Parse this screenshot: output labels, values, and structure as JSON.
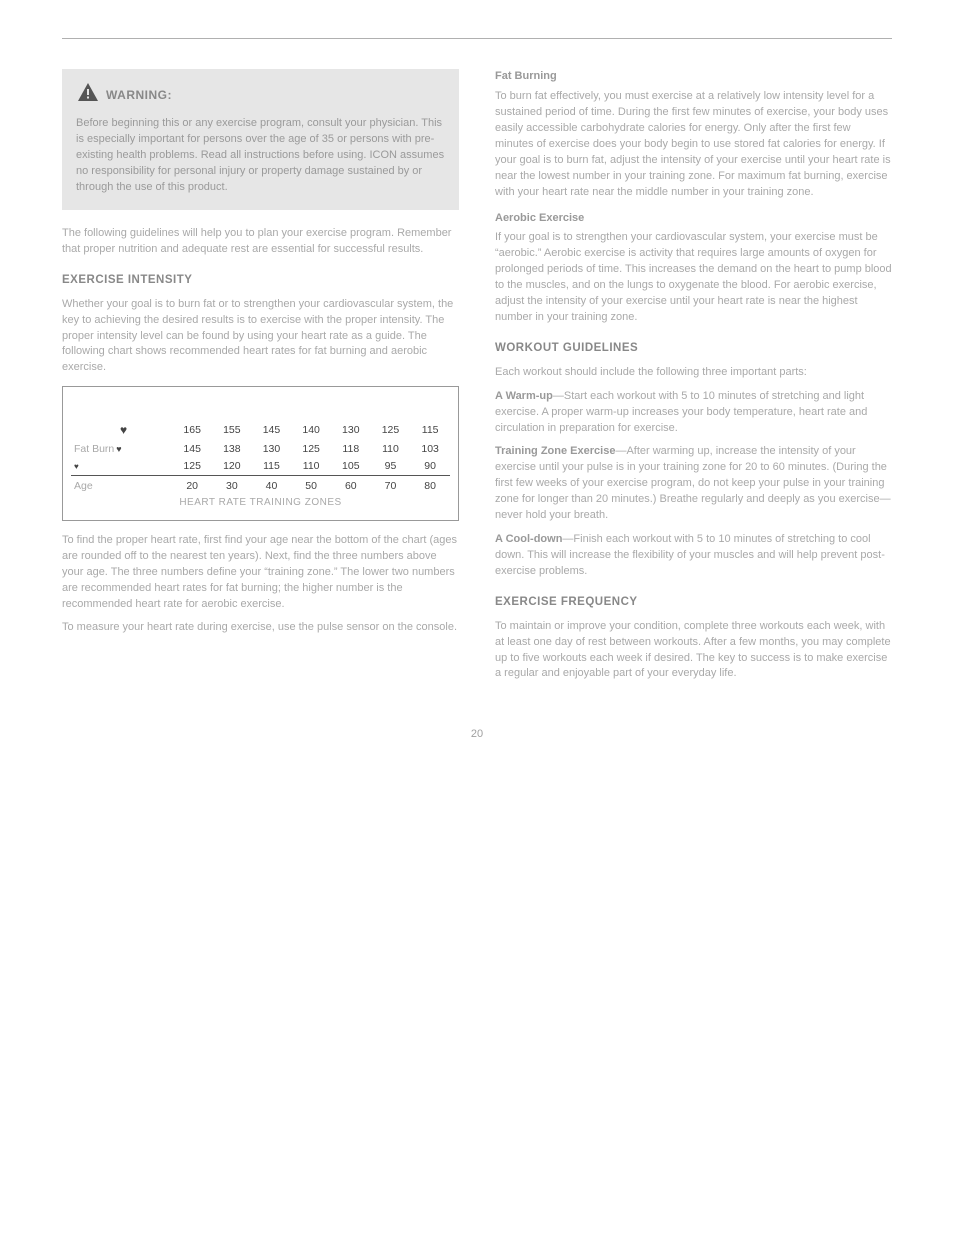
{
  "header_right": "",
  "warning": {
    "label": "WARNING:",
    "body": "Before beginning this or any exercise program, consult your physician. This is especially important for persons over the age of 35 or persons with pre-existing health problems. Read all instructions before using. ICON assumes no responsibility for personal injury or property damage sustained by or through the use of this product."
  },
  "exercise": {
    "para1": "The following guidelines will help you to plan your exercise program. Remember that proper nutrition and adequate rest are essential for successful results.",
    "title": "EXERCISE INTENSITY",
    "para2": "Whether your goal is to burn fat or to strengthen your cardiovascular system, the key to achieving the desired results is to exercise with the proper intensity. The proper intensity level can be found by using your heart rate as a guide. The following chart shows recommended heart rates for fat burning and aerobic exercise."
  },
  "chart_data": {
    "type": "table",
    "title": "",
    "rows": [
      {
        "label": "",
        "icon": "heart-lg",
        "values": [
          165,
          155,
          145,
          140,
          130,
          125,
          115
        ]
      },
      {
        "label": "Fat Burn",
        "icon": "heart-md",
        "values": [
          145,
          138,
          130,
          125,
          118,
          110,
          103
        ]
      },
      {
        "label": "",
        "icon": "heart-sm",
        "values": [
          125,
          120,
          115,
          110,
          105,
          95,
          90
        ]
      },
      {
        "label": "Age",
        "icon": "",
        "values": [
          20,
          30,
          40,
          50,
          60,
          70,
          80
        ]
      }
    ],
    "footer": "HEART RATE TRAINING ZONES"
  },
  "below_chart": {
    "para1": "To find the proper heart rate, first find your age near the bottom of the chart (ages are rounded off to the nearest ten years). Next, find the three numbers above your age. The three numbers define your “training zone.” The lower two numbers are recommended heart rates for fat burning; the higher number is the recommended heart rate for aerobic exercise.",
    "para2": "To measure your heart rate during exercise, use the pulse sensor on the console."
  },
  "right": {
    "fat_title": "Fat Burning",
    "fat_body": "To burn fat effectively, you must exercise at a relatively low intensity level for a sustained period of time. During the first few minutes of exercise, your body uses easily accessible carbohydrate calories for energy. Only after the first few minutes of exercise does your body begin to use stored fat calories for energy. If your goal is to burn fat, adjust the intensity of your exercise until your heart rate is near the lowest number in your training zone. For maximum fat burning, exercise with your heart rate near the middle number in your training zone.",
    "aero_title": "Aerobic Exercise",
    "aero_body": "If your goal is to strengthen your cardiovascular system, your exercise must be “aerobic.” Aerobic exercise is activity that requires large amounts of oxygen for prolonged periods of time. This increases the demand on the heart to pump blood to the muscles, and on the lungs to oxygenate the blood. For aerobic exercise, adjust the intensity of your exercise until your heart rate is near the highest number in your training zone.",
    "wg_title": "WORKOUT GUIDELINES",
    "wg_body": "Each workout should include the following three important parts:",
    "warm_label": "A Warm-up",
    "warm_body": "—Start each workout with 5 to 10 minutes of stretching and light exercise. A proper warm-up increases your body temperature, heart rate and circulation in preparation for exercise.",
    "tz_label": "Training Zone Exercise",
    "tz_body": "—After warming up, increase the intensity of your exercise until your pulse is in your training zone for 20 to 60 minutes. (During the first few weeks of your exercise program, do not keep your pulse in your training zone for longer than 20 minutes.) Breathe regularly and deeply as you exercise—never hold your breath.",
    "cd_label": "A Cool-down",
    "cd_body": "—Finish each workout with 5 to 10 minutes of stretching to cool down. This will increase the flexibility of your muscles and will help prevent post-exercise problems.",
    "ef_title": "EXERCISE FREQUENCY",
    "ef_body": "To maintain or improve your condition, complete three workouts each week, with at least one day of rest between workouts. After a few months, you may complete up to five workouts each week if desired. The key to success is to make exercise a regular and enjoyable part of your everyday life."
  },
  "page_number": "20"
}
